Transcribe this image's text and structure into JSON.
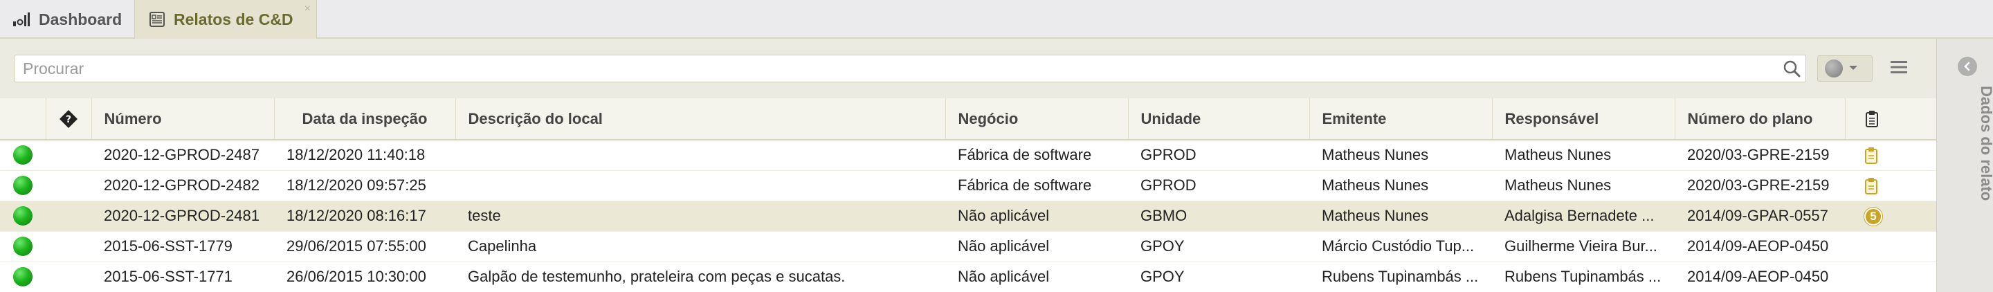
{
  "tabs": [
    {
      "label": "Dashboard",
      "icon": "bar-chart-icon",
      "active": false
    },
    {
      "label": "Relatos de C&D",
      "icon": "report-icon",
      "active": true,
      "close": "×"
    }
  ],
  "search": {
    "placeholder": "Procurar",
    "value": ""
  },
  "table": {
    "columns": [
      "",
      "",
      "Número",
      "Data da inspeção",
      "Descrição do local",
      "Negócio",
      "Unidade",
      "Emitente",
      "Responsável",
      "Número do plano",
      ""
    ],
    "rows": [
      {
        "numero": "2020-12-GPROD-2487",
        "data": "18/12/2020 11:40:18",
        "descricao": "",
        "negocio": "Fábrica de software",
        "unidade": "GPROD",
        "emitente": "Matheus Nunes",
        "responsavel": "Matheus Nunes",
        "plano": "2020/03-GPRE-2159",
        "extra": "clipboard",
        "badge": ""
      },
      {
        "numero": "2020-12-GPROD-2482",
        "data": "18/12/2020 09:57:25",
        "descricao": "",
        "negocio": "Fábrica de software",
        "unidade": "GPROD",
        "emitente": "Matheus Nunes",
        "responsavel": "Matheus Nunes",
        "plano": "2020/03-GPRE-2159",
        "extra": "clipboard",
        "badge": ""
      },
      {
        "numero": "2020-12-GPROD-2481",
        "data": "18/12/2020 08:16:17",
        "descricao": "teste",
        "negocio": "Não aplicável",
        "unidade": "GBMO",
        "emitente": "Matheus Nunes",
        "responsavel": "Adalgisa Bernadete ...",
        "plano": "2014/09-GPAR-0557",
        "extra": "badge",
        "badge": "5"
      },
      {
        "numero": "2015-06-SST-1779",
        "data": "29/06/2015 07:55:00",
        "descricao": "Capelinha",
        "negocio": "Não aplicável",
        "unidade": "GPOY",
        "emitente": "Márcio Custódio Tup...",
        "responsavel": "Guilherme Vieira Bur...",
        "plano": "2014/09-AEOP-0450",
        "extra": "",
        "badge": ""
      },
      {
        "numero": "2015-06-SST-1771",
        "data": "26/06/2015 10:30:00",
        "descricao": "Galpão de testemunho, prateleira com peças e sucatas.",
        "negocio": "Não aplicável",
        "unidade": "GPOY",
        "emitente": "Rubens Tupinambás ...",
        "responsavel": "Rubens Tupinambás ...",
        "plano": "2014/09-AEOP-0450",
        "extra": "",
        "badge": ""
      }
    ],
    "selected_row": 2
  },
  "side_panel": {
    "label": "Dados do relato"
  },
  "colors": {
    "status_green": "#1fb51f",
    "badge": "#c9a425",
    "clipboard": "#c9a425",
    "accent_tab": "#6a6a30"
  }
}
